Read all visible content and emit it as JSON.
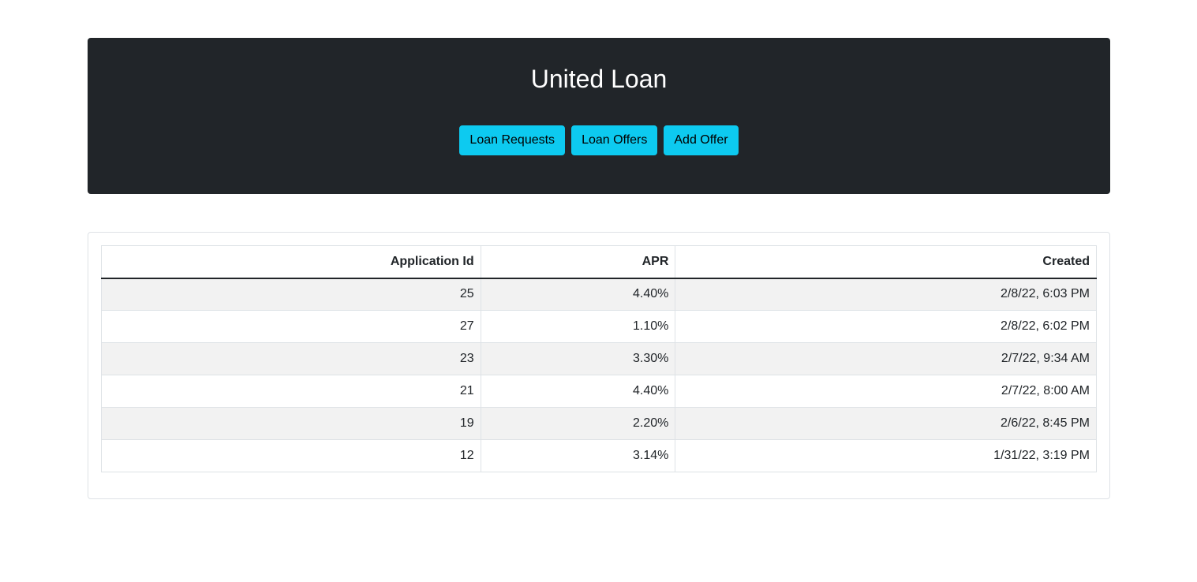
{
  "header": {
    "title": "United Loan",
    "buttons": {
      "loan_requests": "Loan Requests",
      "loan_offers": "Loan Offers",
      "add_offer": "Add Offer"
    }
  },
  "table": {
    "columns": [
      "Application Id",
      "APR",
      "Created"
    ],
    "rows": [
      [
        "25",
        "4.40%",
        "2/8/22, 6:03 PM"
      ],
      [
        "27",
        "1.10%",
        "2/8/22, 6:02 PM"
      ],
      [
        "23",
        "3.30%",
        "2/7/22, 9:34 AM"
      ],
      [
        "21",
        "4.40%",
        "2/7/22, 8:00 AM"
      ],
      [
        "19",
        "2.20%",
        "2/6/22, 8:45 PM"
      ],
      [
        "12",
        "3.14%",
        "1/31/22, 3:19 PM"
      ]
    ]
  },
  "colors": {
    "header_bg": "#212529",
    "button_bg": "#0dcaf0",
    "striped_row_bg": "#f2f2f2",
    "border": "#dee2e6"
  }
}
